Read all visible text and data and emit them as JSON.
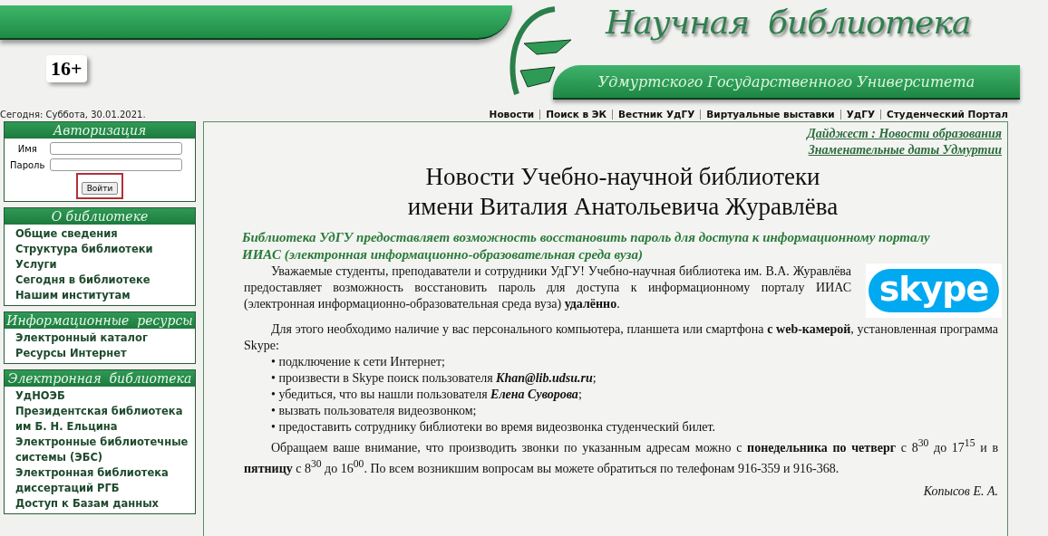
{
  "header": {
    "title": "Научная  библиотека",
    "subtitle": "Удмуртского Государственного Университета",
    "age_rating": "16+"
  },
  "date_line": "Сегодня: Суббота, 30.01.2021.",
  "top_nav": [
    "Новости",
    "Поиск в ЭК",
    "Вестник УдГУ",
    "Виртуальные выставки",
    "УдГУ",
    "Студенческий Портал"
  ],
  "login": {
    "title": "Авторизация",
    "fields": [
      {
        "label": "Имя"
      },
      {
        "label": "Пароль"
      }
    ],
    "button": "Войти",
    "highlighted": true
  },
  "sidebar_sections": [
    {
      "title": "О библиотеке",
      "items": [
        "Общие сведения",
        "Структура библиотеки",
        "Услуги",
        "Сегодня в библиотеке",
        "Нашим институтам"
      ]
    },
    {
      "title": "Информационные  ресурсы",
      "items": [
        "Электронный каталог",
        "Ресурсы Интернет"
      ]
    },
    {
      "title": "Электронная  библиотека",
      "items": [
        "УдНОЭБ",
        "Президентская библиотека им Б. Н. Ельцина",
        "Электронные библиотечные системы (ЭБС)",
        "Электронная библиотека диссертаций РГБ",
        "Доступ к Базам данных"
      ]
    }
  ],
  "side_links": [
    "Дайджест : Новости образования",
    "Знаменательные даты Удмуртии"
  ],
  "headline": [
    "Новости Учебно-научной библиотеки",
    "имени Виталия Анатольевича Журавлёва"
  ],
  "lead": "Библиотека УдГУ предоставляет возможность восстановить пароль для доступа к информационному порталу ИИАС (электронная информационно-образовательная среда вуза)",
  "skype_logo": "skype",
  "paragraphs": [
    "Уважаемые студенты, преподаватели и сотрудники УдГУ! Учебно-научная библиотека им. В.А. Журавлёва предоставляет возможность восстановить пароль для доступа к информационному порталу ИИАС (электронная информационно-образовательная среда вуза) **удалённо**.",
    "Для этого необходимо наличие у вас персонального компьютера, планшета или смартфона **с web-камерой**, установленная программа Skype:"
  ],
  "steps": [
    "• подключение к сети Интернет;",
    "• произвести в Skype поиск пользователя **Khan@lib.udsu.ru**;",
    "• убедиться, что вы нашли пользователя **Елена Суворова**;",
    "• вызвать пользователя видеозвонком;",
    "• предоставить сотруднику библиотеки во время видеозвонка студенческий билет."
  ],
  "closing": "Обращаем ваше внимание, что производить звонки по указанным адресам можно с **понедельника по четверг** с 8$^{30}$ до 17$^{15}$ и в **пятницу** с 8$^{30}$ до 16$^{00}$. По всем возникшим вопросам вы можете обратиться по телефонам 916-359 и 916-368.",
  "signature": "Копысов Е. А."
}
